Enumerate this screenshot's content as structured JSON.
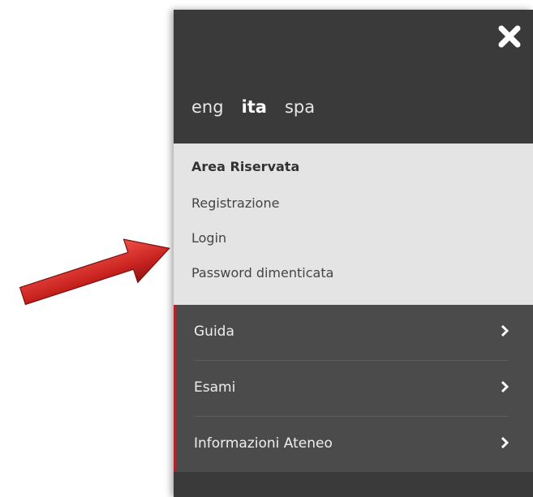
{
  "language_bar": {
    "items": [
      "eng",
      "ita",
      "spa"
    ],
    "active": "ita"
  },
  "reserved_area": {
    "title": "Area Riservata",
    "links": [
      "Registrazione",
      "Login",
      "Password dimenticata"
    ]
  },
  "nav": {
    "items": [
      "Guida",
      "Esami",
      "Informazioni Ateneo"
    ]
  },
  "icons": {
    "close": "close-icon",
    "chevron": "chevron-right-icon",
    "pointer": "arrow-pointer-icon"
  },
  "colors": {
    "panel_dark": "#3a3a3a",
    "reserved_bg": "#e4e4e4",
    "nav_bg": "#4b4b4b",
    "accent_red": "#b0242c",
    "arrow_red": "#cf2a27"
  }
}
